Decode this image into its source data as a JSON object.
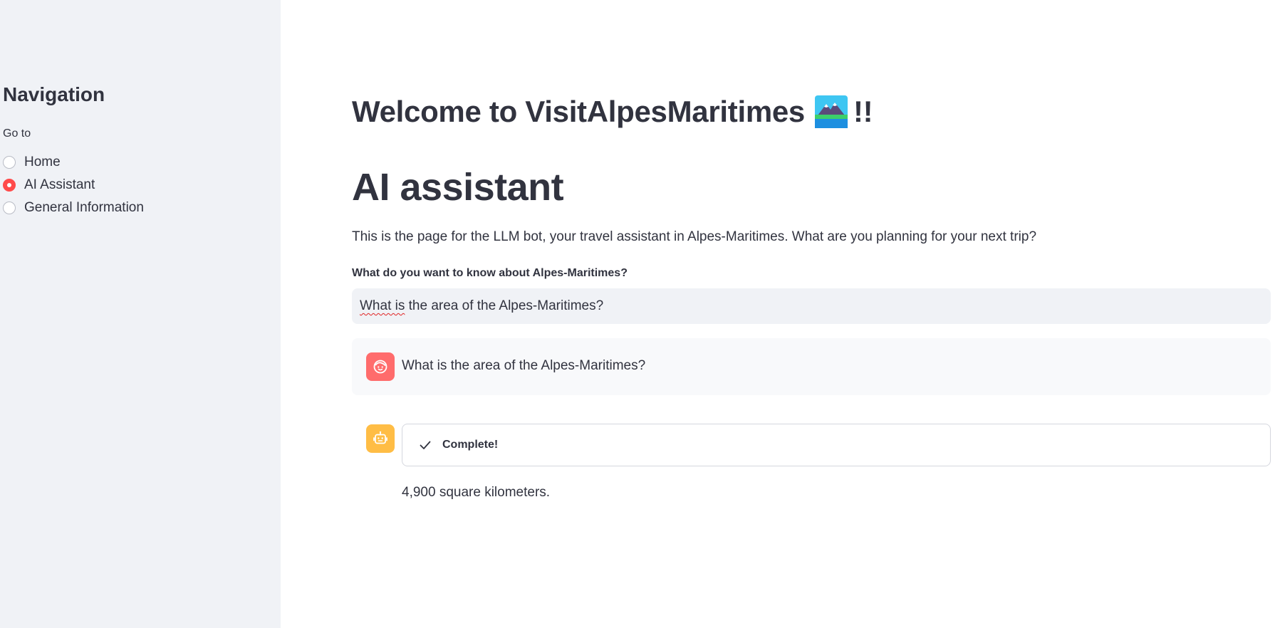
{
  "sidebar": {
    "title": "Navigation",
    "goto_label": "Go to",
    "options": [
      {
        "label": "Home",
        "selected": false
      },
      {
        "label": "AI Assistant",
        "selected": true
      },
      {
        "label": "General Information",
        "selected": false
      }
    ]
  },
  "main": {
    "welcome_prefix": "Welcome to VisitAlpesMaritimes",
    "welcome_icon": "mountain-landscape-emoji",
    "welcome_suffix": "!!",
    "heading": "AI assistant",
    "intro": "This is the page for the LLM bot, your travel assistant in Alpes-Maritimes. What are you planning for your next trip?",
    "input_label": "What do you want to know about Alpes-Maritimes?",
    "input_value_misspelled": "What is",
    "input_value_rest": " the area of the Alpes-Maritimes?",
    "chat": {
      "user_message": "What is the area of the Alpes-Maritimes?",
      "user_avatar_icon": "user-face-icon",
      "bot_avatar_icon": "robot-icon",
      "status": "Complete!",
      "answer": "4,900 square kilometers."
    }
  },
  "colors": {
    "sidebar_bg": "#f0f2f6",
    "accent": "#ff4b4b",
    "user_avatar": "#ff6c6c",
    "bot_avatar": "#ffbd45",
    "text": "#31333f"
  }
}
